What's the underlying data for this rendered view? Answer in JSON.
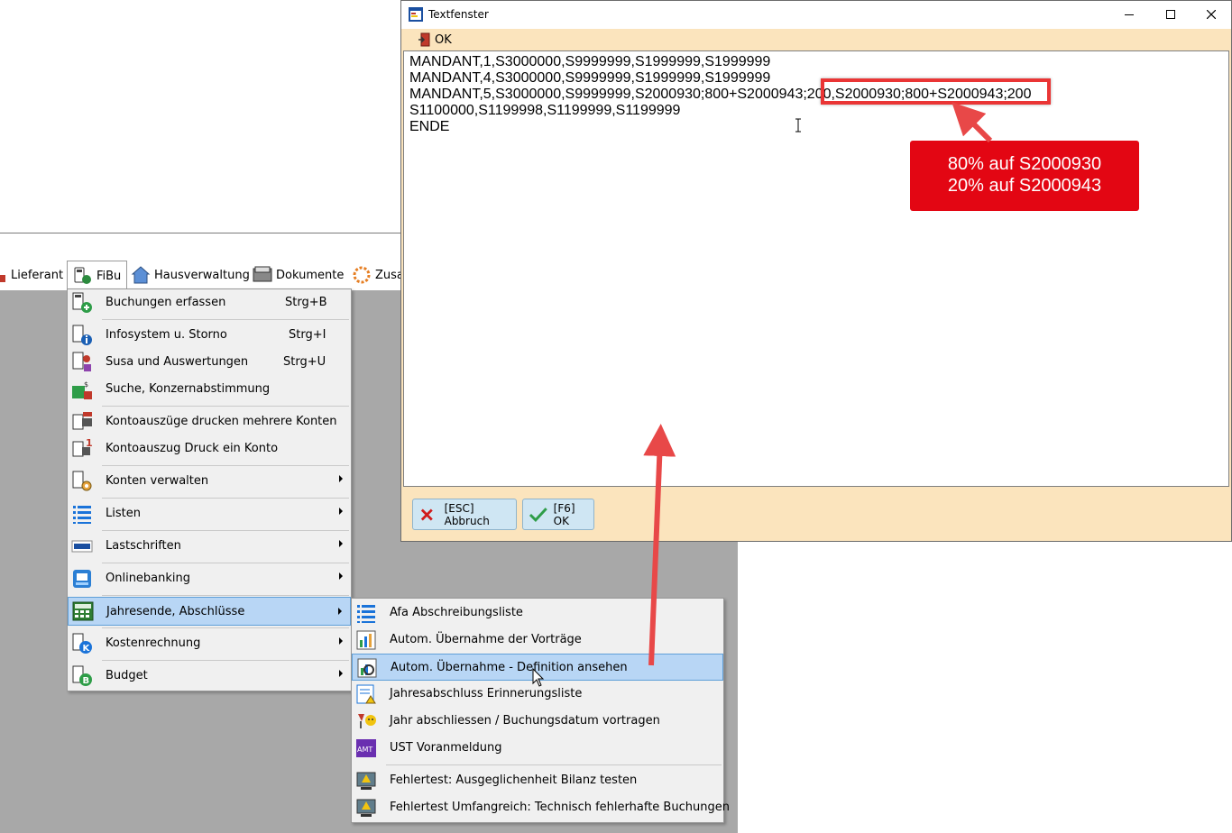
{
  "menubar": {
    "items": [
      {
        "label": "Lieferant"
      },
      {
        "label": "FiBu"
      },
      {
        "label": "Hausverwaltung"
      },
      {
        "label": "Dokumente"
      },
      {
        "label": "Zusa"
      }
    ]
  },
  "fibu_menu": {
    "items": [
      {
        "label": "Buchungen erfassen",
        "shortcut": "Strg+B"
      },
      {
        "label": "Infosystem u. Storno",
        "shortcut": "Strg+I"
      },
      {
        "label": "Susa und Auswertungen",
        "shortcut": "Strg+U"
      },
      {
        "label": "Suche, Konzernabstimmung"
      },
      {
        "label": "Kontoauszüge drucken mehrere Konten"
      },
      {
        "label": "Kontoauszug Druck ein Konto"
      },
      {
        "label": "Konten verwalten"
      },
      {
        "label": "Listen"
      },
      {
        "label": "Lastschriften"
      },
      {
        "label": "Onlinebanking"
      },
      {
        "label": "Jahresende, Abschlüsse"
      },
      {
        "label": "Kostenrechnung"
      },
      {
        "label": "Budget"
      }
    ]
  },
  "submenu": {
    "items": [
      {
        "label": "Afa Abschreibungsliste"
      },
      {
        "label": "Autom. Übernahme der Vorträge"
      },
      {
        "label": "Autom. Übernahme - Definition ansehen"
      },
      {
        "label": "Jahresabschluss Erinnerungsliste"
      },
      {
        "label": "Jahr abschliessen / Buchungsdatum vortragen"
      },
      {
        "label": "UST Voranmeldung"
      },
      {
        "label": "Fehlertest: Ausgeglichenheit Bilanz testen"
      },
      {
        "label": "Fehlertest Umfangreich: Technisch fehlerhafte Buchungen"
      }
    ],
    "amt_icon_text": "AMT"
  },
  "textwindow": {
    "title": "Textfenster",
    "toolbar_ok": "OK",
    "lines": [
      "MANDANT,1,S3000000,S9999999,S1999999,S1999999",
      "MANDANT,4,S3000000,S9999999,S1999999,S1999999",
      "MANDANT,5,S3000000,S9999999,S2000930;800+S2000943;200,S2000930;800+S2000943;200",
      "S1100000,S1199998,S1199999,S1199999",
      "ENDE"
    ],
    "cancel_label": "[ESC] Abbruch",
    "ok_label": "[F6] OK"
  },
  "annotation": {
    "line1": "80% auf S2000930",
    "line2": "20% auf S2000943",
    "color": "#e30613"
  },
  "icons": {
    "window_app": "app-icon",
    "minimize": "minimize-icon",
    "maximize": "maximize-icon",
    "close": "close-icon"
  }
}
